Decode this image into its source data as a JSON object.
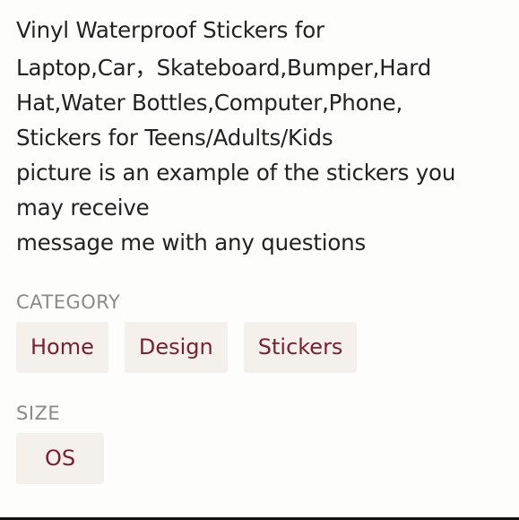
{
  "description": {
    "lines": [
      "Vinyl Waterproof Stickers for",
      "Laptop,Car，Skateboard,Bumper,Hard",
      "Hat,Water Bottles,Computer,Phone,",
      "Stickers for Teens/Adults/Kids",
      "picture is an example of the stickers you",
      "may receive",
      "message me with any questions"
    ]
  },
  "category": {
    "label": "CATEGORY",
    "chips": [
      "Home",
      "Design",
      "Stickers"
    ]
  },
  "size": {
    "label": "SIZE",
    "chips": [
      "OS"
    ]
  },
  "colors": {
    "chip_text": "#7a1f2f",
    "chip_bg": "#f4f0ec",
    "label_text": "#8a8a86",
    "body_text": "#222222"
  }
}
